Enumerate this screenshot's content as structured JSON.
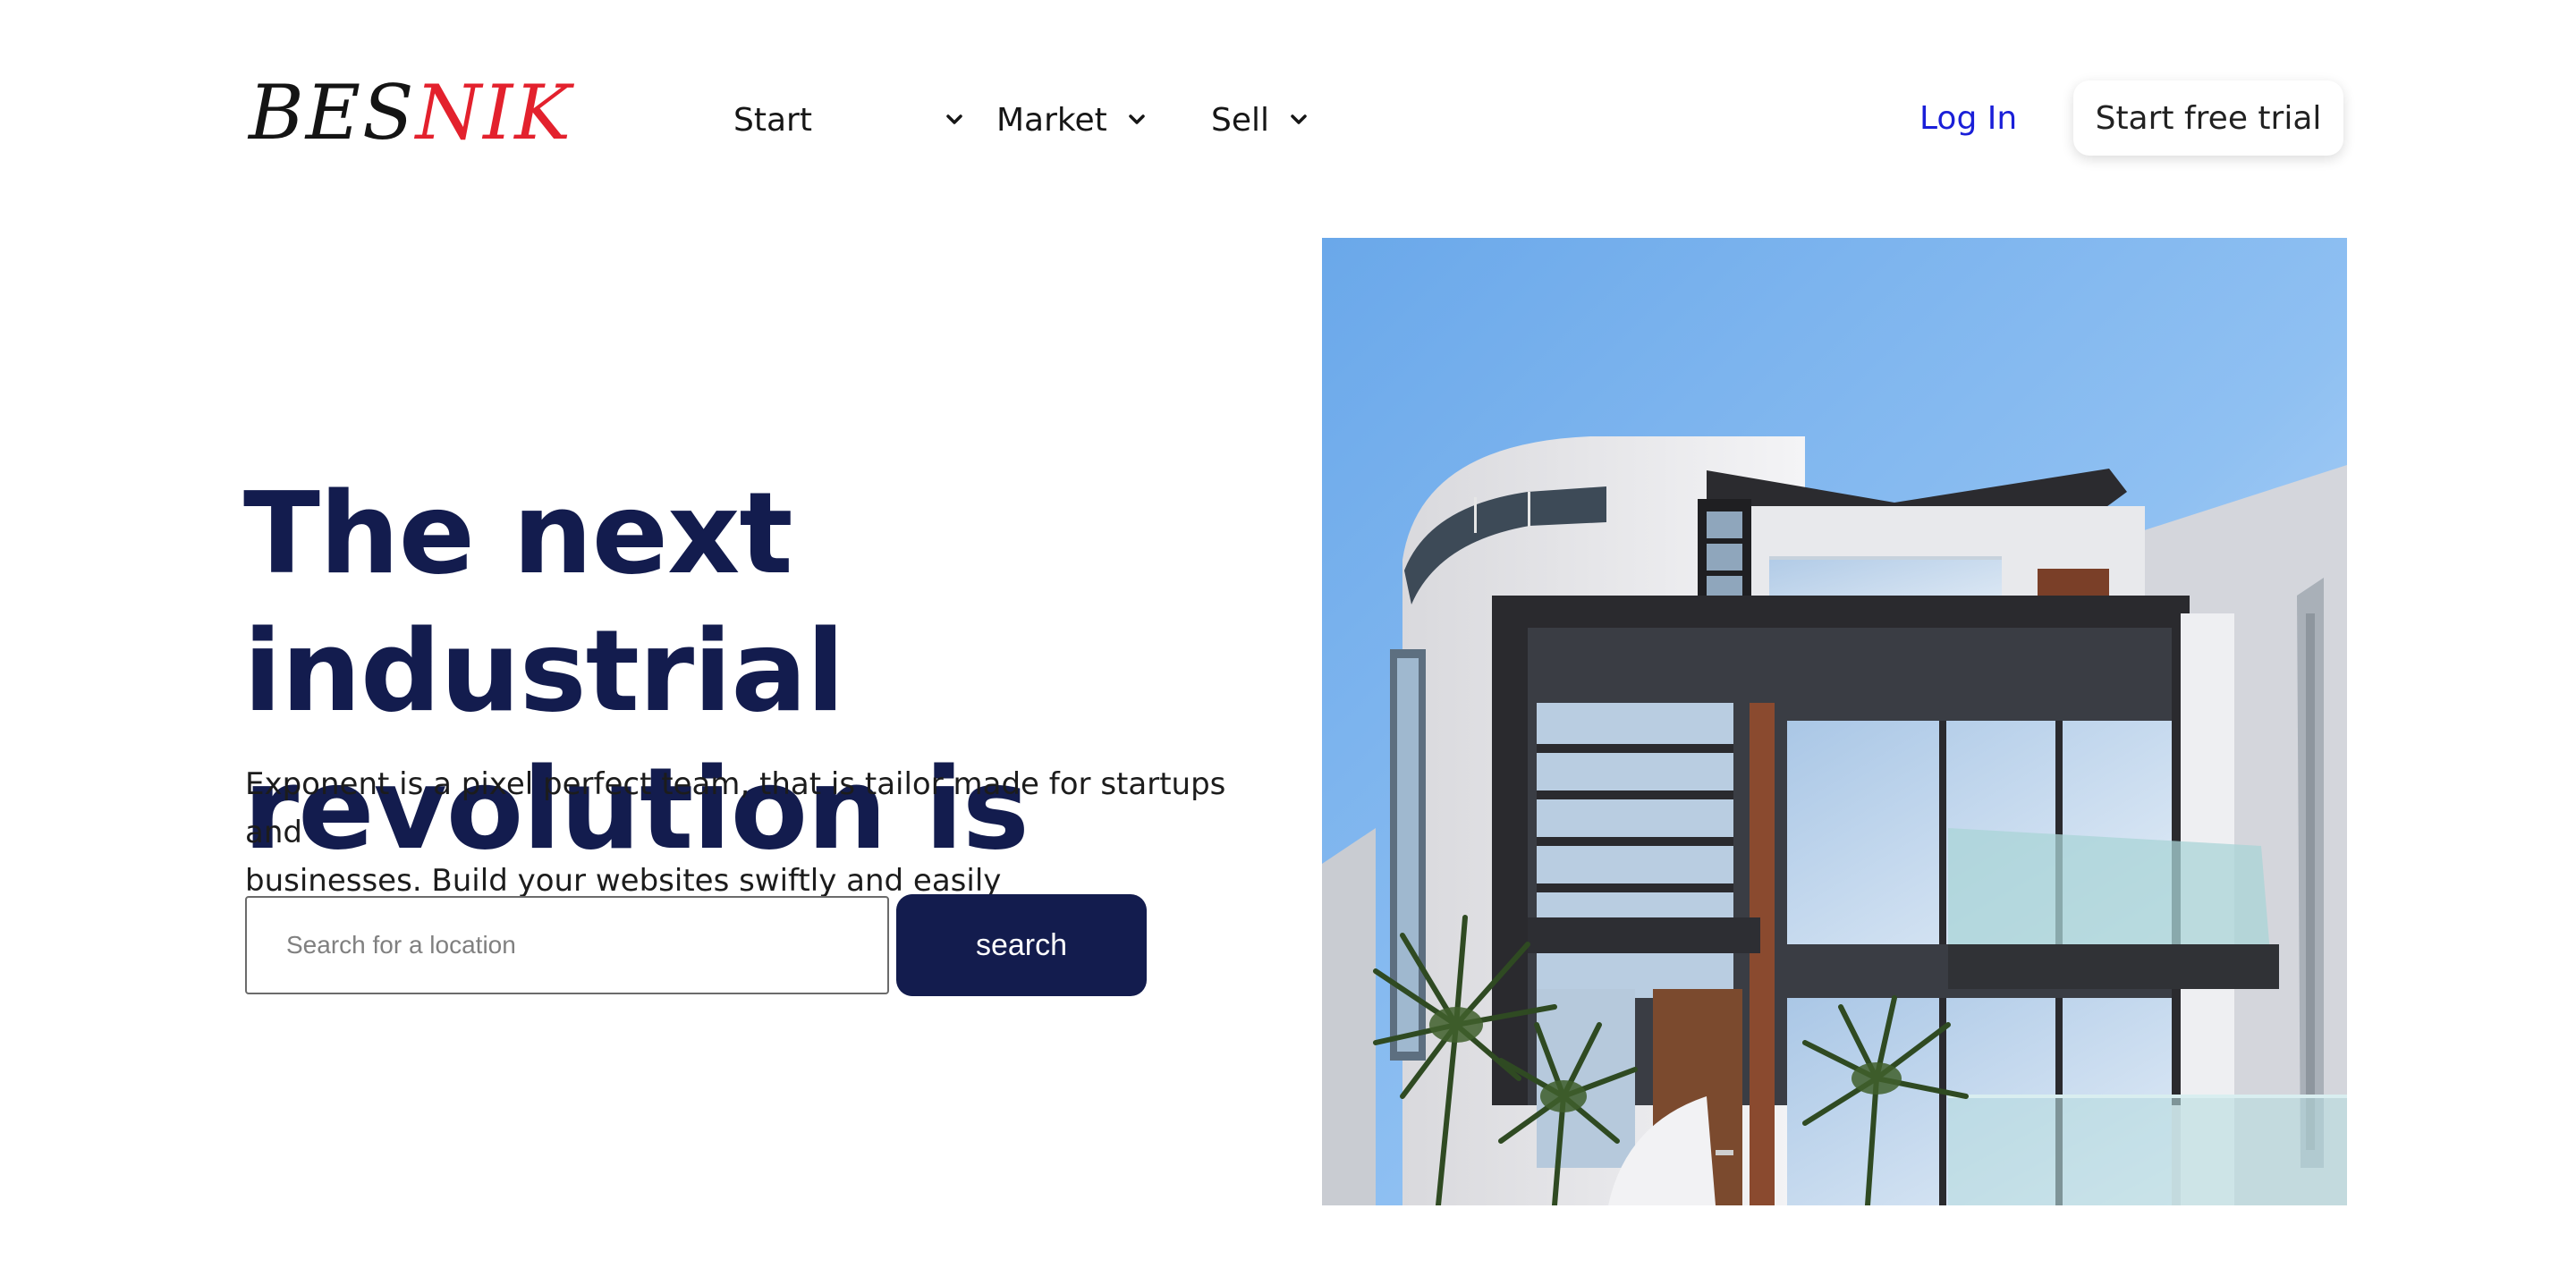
{
  "header": {
    "logo": {
      "part1": "BES",
      "part2": "NIK"
    },
    "nav": [
      {
        "label": "Start"
      },
      {
        "label": "Market"
      },
      {
        "label": "Sell"
      }
    ],
    "login_label": "Log In",
    "trial_label": "Start free trial"
  },
  "hero": {
    "title_line1": "The next industrial",
    "title_line2": "revolution is here",
    "description_line1": "Exponent is a pixel perfect team, that is tailor made for startups and",
    "description_line2": "businesses. Build your websites swiftly and easily",
    "search": {
      "placeholder": "Search for a location",
      "button_label": "search"
    }
  },
  "colors": {
    "brand_navy": "#131c4e",
    "logo_red": "#e3212d",
    "link_blue": "#1a1fd8"
  }
}
